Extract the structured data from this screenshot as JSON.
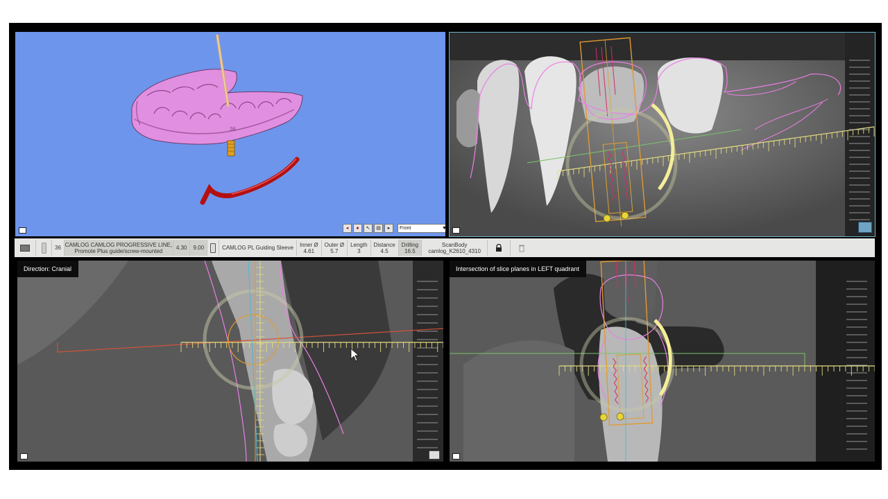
{
  "panes": {
    "view3d": {
      "view_select_value": "Front",
      "tooth_number": "36"
    },
    "cranial": {
      "label": "Direction: Cranial"
    },
    "cross": {
      "label": "Intersection of slice planes in LEFT quadrant"
    }
  },
  "implant_bar": {
    "index": "36",
    "implant_line1": "CAMLOG CAMLOG PROGRESSIVE LINE,",
    "implant_line2": "Promote Plus guide/screw-mounted",
    "diameter": "4.30",
    "length_value": "9.00",
    "sleeve": "CAMLOG PL Guiding Sleeve",
    "inner_label": "Inner Ø",
    "inner_value": "4.61",
    "outer_label": "Outer Ø",
    "outer_value": "5.7",
    "length_label": "Length",
    "length_sleeve": "3",
    "distance_label": "Distance",
    "distance_value": "4.5",
    "drilling_label": "Drilling",
    "drilling_value": "16.5",
    "scanbody_label": "ScanBody",
    "scanbody_value": "camlog_K2610_4310"
  },
  "colors": {
    "viewport_3d": "#6d95ec",
    "model": "#e792e6",
    "implant_outline": "#e8a030",
    "nerve": "#cc1111",
    "ruler": "#e4dc80"
  },
  "icons": [
    "front-view-icon",
    "implant-icon",
    "sleeve-icon",
    "lock-icon",
    "delete-icon",
    "layers-icon",
    "fullscreen-icon"
  ]
}
